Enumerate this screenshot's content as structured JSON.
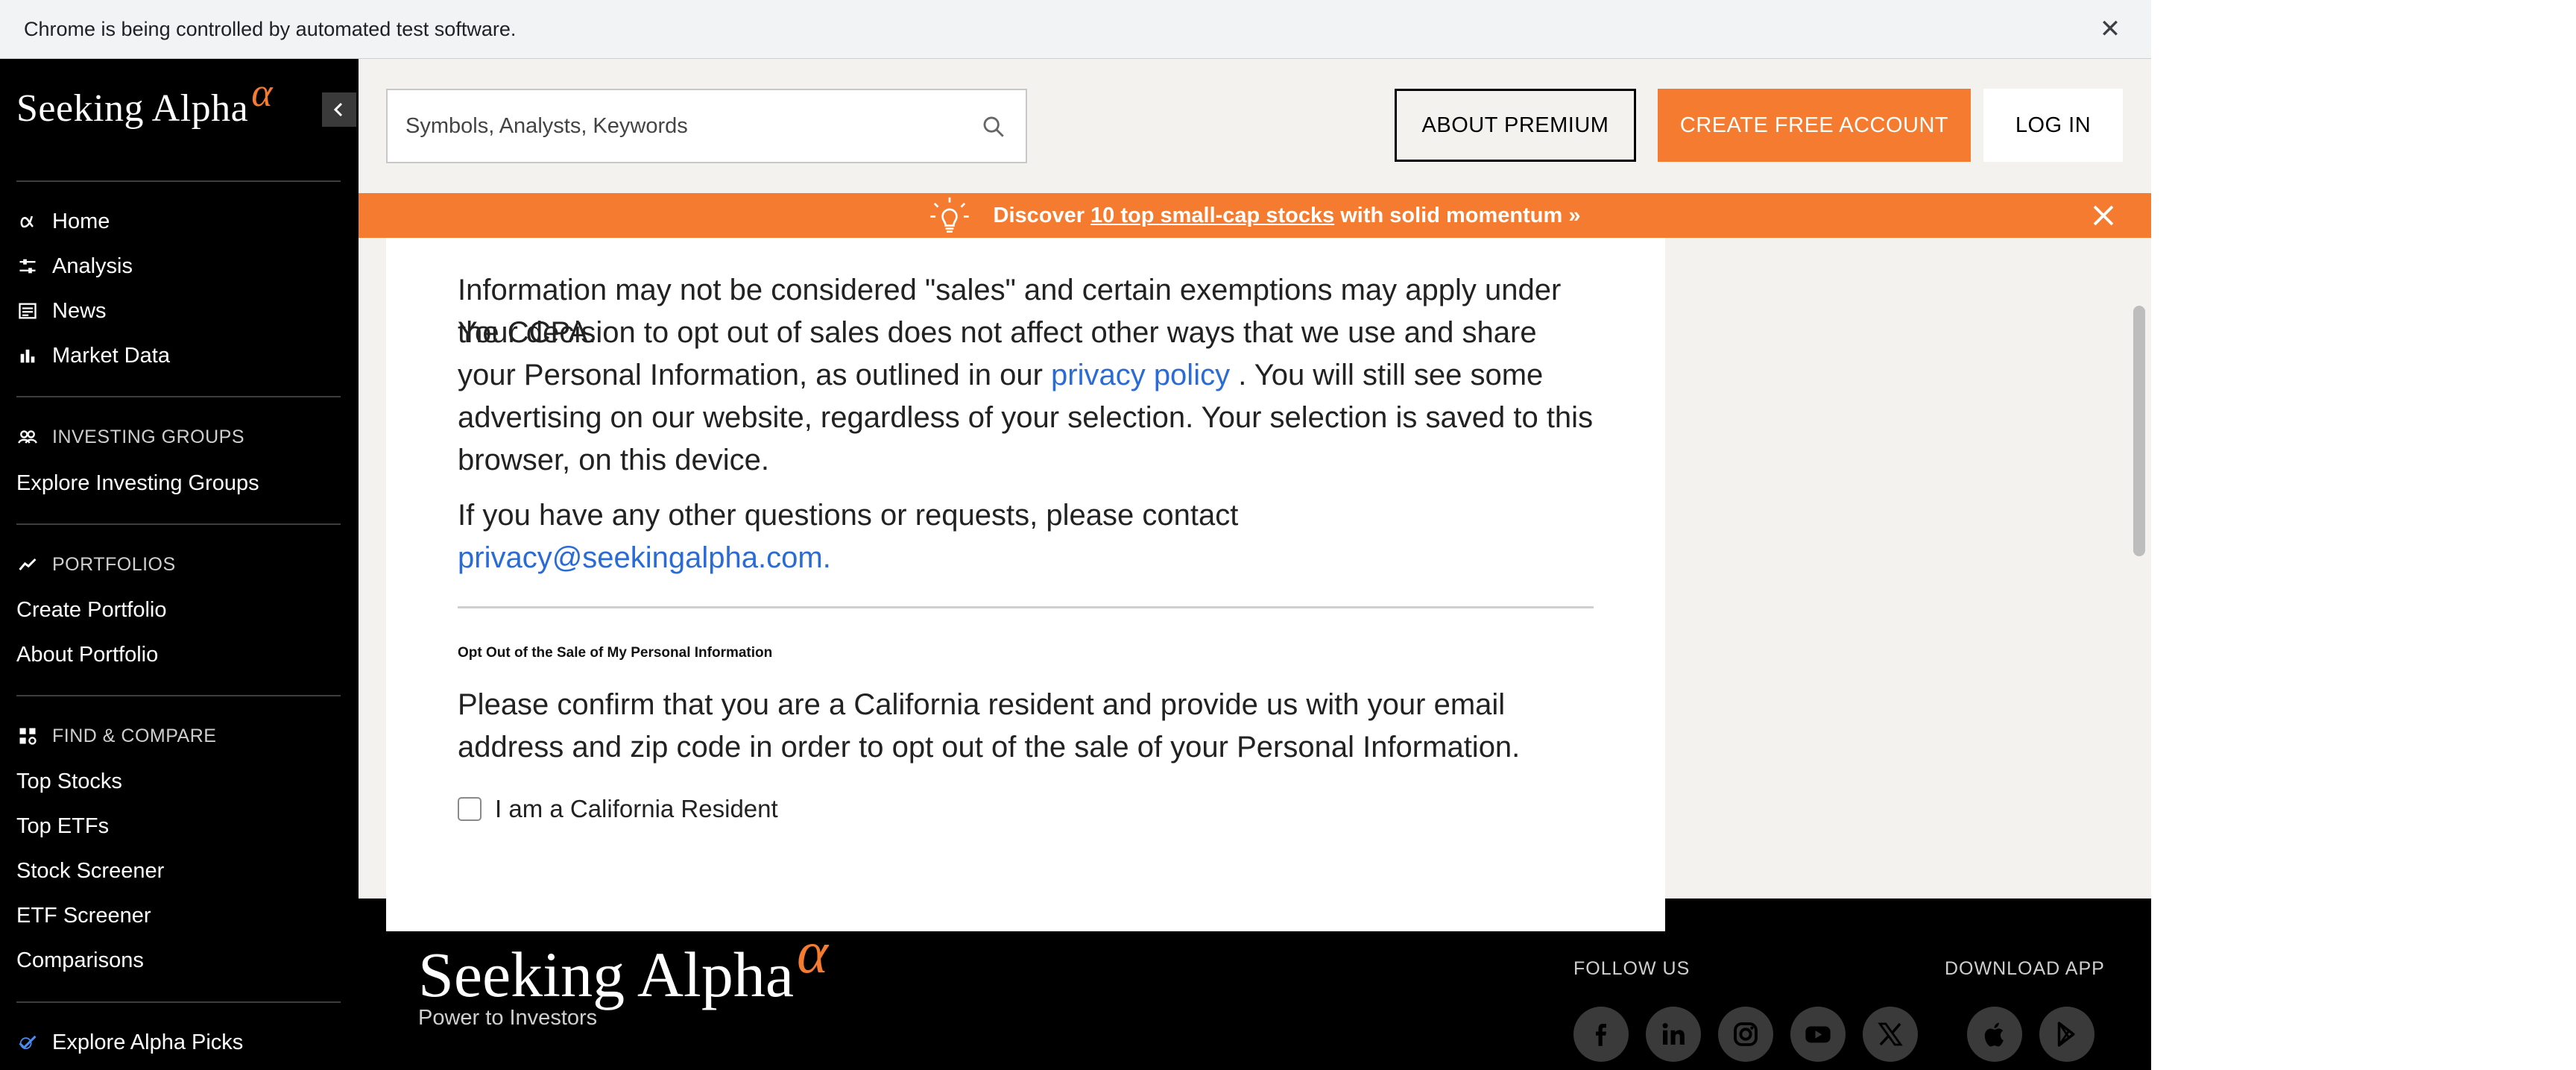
{
  "infobar": {
    "message": "Chrome is being controlled by automated test software.",
    "close_icon": "close-icon"
  },
  "sidebar": {
    "logo_text": "Seeking Alpha",
    "logo_mark": "α",
    "main_nav": [
      {
        "label": "Home",
        "icon": "alpha-icon"
      },
      {
        "label": "Analysis",
        "icon": "sliders-icon"
      },
      {
        "label": "News",
        "icon": "news-icon"
      },
      {
        "label": "Market Data",
        "icon": "bar-chart-icon"
      }
    ],
    "investing_groups": {
      "heading": "INVESTING GROUPS",
      "icon": "group-icon",
      "items": [
        "Explore Investing Groups"
      ]
    },
    "portfolios": {
      "heading": "PORTFOLIOS",
      "icon": "trend-icon",
      "items": [
        "Create Portfolio",
        "About Portfolio"
      ]
    },
    "find_compare": {
      "heading": "FIND & COMPARE",
      "icon": "grid-icon",
      "items": [
        "Top Stocks",
        "Top ETFs",
        "Stock Screener",
        "ETF Screener",
        "Comparisons"
      ]
    },
    "alpha_picks": {
      "label": "Explore Alpha Picks",
      "icon": "check-alpha-icon"
    }
  },
  "header": {
    "search_placeholder": "Symbols, Analysts, Keywords",
    "about_premium": "ABOUT PREMIUM",
    "create_account": "CREATE FREE ACCOUNT",
    "log_in": "LOG IN"
  },
  "banner": {
    "prefix": "Discover",
    "link": "10 top small-cap stocks",
    "suffix": "with solid momentum »"
  },
  "content": {
    "para1_line0": "Information may not be considered \"sales\" and certain exemptions may apply under the CCPA.",
    "para1_rest_a": "Your decision to opt out of sales does not affect other ways that we use and share your Personal Information, as outlined in our ",
    "privacy_link": "privacy policy",
    "para1_rest_b": " . You will still see some advertising on our website, regardless of your selection. Your selection is saved to this browser, on this device.",
    "para2_text": "If you have any other questions or requests, please contact ",
    "para2_email": "privacy@seekingalpha.com.",
    "opt_out_title": "Opt Out of the Sale of My Personal Information",
    "confirm_text": "Please confirm that you are a California resident and provide us with your email address and zip code in order to opt out of the sale of your Personal Information.",
    "checkbox_label": "I am a California Resident"
  },
  "footer": {
    "logo_text": "Seeking Alpha",
    "logo_mark": "α",
    "tagline": "Power to Investors",
    "follow_label": "FOLLOW US",
    "download_label": "DOWNLOAD APP",
    "social": [
      "facebook-icon",
      "linkedin-icon",
      "instagram-icon",
      "youtube-icon",
      "x-icon"
    ],
    "apps": [
      "apple-icon",
      "google-play-icon"
    ]
  },
  "colors": {
    "accent": "#f47b2f",
    "link": "#2a6bd6",
    "sidebar_bg": "#000000",
    "page_bg": "#f4f2ef"
  }
}
